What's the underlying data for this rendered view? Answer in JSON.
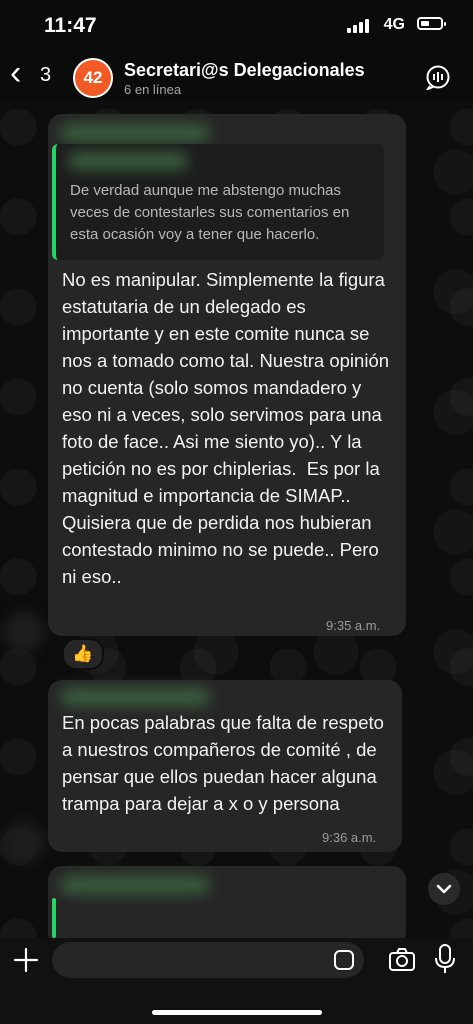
{
  "status_bar": {
    "time": "11:47",
    "network": "4G"
  },
  "header": {
    "back_count": "3",
    "avatar_text": "42",
    "title": "Secretari@s Delegacionales",
    "subtitle": "6 en línea"
  },
  "messages": [
    {
      "quoted_text": "De verdad aunque me abstengo muchas veces de contestarles sus comentarios en esta ocasión voy a tener que hacerlo.",
      "text": "No es manipular. Simplemente la figura estatutaria de un delegado es importante y en este comite nunca se nos a tomado como tal. Nuestra opinión no cuenta (solo somos mandadero y eso ni a veces, solo servimos para una foto de face.. Asi me siento yo).. Y la petición no es por chiplerias.  Es por la magnitud e importancia de SIMAP..  Quisiera que de perdida nos hubieran contestado minimo no se puede.. Pero ni eso..",
      "time": "9:35 a.m.",
      "reaction": "👍"
    },
    {
      "text": "En pocas palabras que falta de respeto a nuestros compañeros de comité , de pensar que ellos puedan hacer alguna trampa para dejar a x o y persona",
      "time": "9:36 a.m."
    }
  ],
  "icons": {
    "back": "chevron-left-icon",
    "call": "call-add-icon",
    "plus": "plus-icon",
    "sticker": "sticker-icon",
    "camera": "camera-icon",
    "mic": "mic-icon",
    "scroll": "chevron-down-icon",
    "reaction": "thumbs-up-icon"
  },
  "colors": {
    "accent": "#25d366",
    "bubble": "#262626",
    "background": "#0b0b0b"
  }
}
